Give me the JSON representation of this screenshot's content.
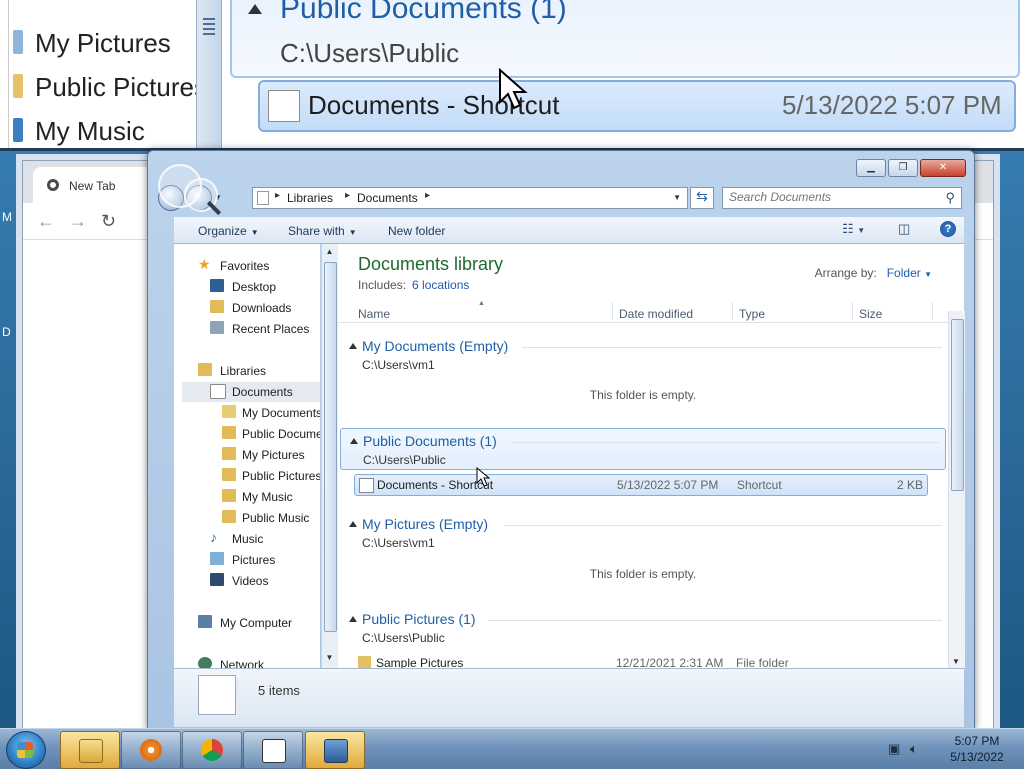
{
  "zoom": {
    "nav_items": [
      "My Pictures",
      "Public Pictures",
      "My Music"
    ],
    "group_title": "Public Documents (1)",
    "group_path": "C:\\Users\\Public",
    "item_name": "Documents - Shortcut",
    "item_date": "5/13/2022 5:07 PM"
  },
  "chrome": {
    "tab_title": "New Tab"
  },
  "explorer": {
    "address": {
      "crumbs": [
        "Libraries",
        "Documents"
      ]
    },
    "search_placeholder": "Search Documents",
    "toolbar": {
      "organize": "Organize",
      "share_with": "Share with",
      "new_folder": "New folder"
    },
    "nav": {
      "favorites": "Favorites",
      "desktop": "Desktop",
      "downloads": "Downloads",
      "recent_places": "Recent Places",
      "libraries": "Libraries",
      "documents": "Documents",
      "my_documents": "My Documents",
      "public_documents": "Public Documents",
      "my_pictures": "My Pictures",
      "public_pictures": "Public Pictures",
      "my_music": "My Music",
      "public_music": "Public Music",
      "music": "Music",
      "pictures": "Pictures",
      "videos": "Videos",
      "my_computer": "My Computer",
      "network": "Network"
    },
    "library": {
      "title": "Documents library",
      "includes_label": "Includes:",
      "locations": "6 locations",
      "arrange_by_label": "Arrange by:",
      "arrange_by_value": "Folder"
    },
    "columns": {
      "name": "Name",
      "date_modified": "Date modified",
      "type": "Type",
      "size": "Size"
    },
    "groups": [
      {
        "title": "My Documents (Empty)",
        "path": "C:\\Users\\vm1",
        "empty_text": "This folder is empty."
      },
      {
        "title": "Public Documents (1)",
        "path": "C:\\Users\\Public",
        "items": [
          {
            "name": "Documents - Shortcut",
            "date": "5/13/2022 5:07 PM",
            "type": "Shortcut",
            "size": "2 KB"
          }
        ]
      },
      {
        "title": "My Pictures (Empty)",
        "path": "C:\\Users\\vm1",
        "empty_text": "This folder is empty."
      },
      {
        "title": "Public Pictures (1)",
        "path": "C:\\Users\\Public",
        "items": [
          {
            "name": "Sample Pictures",
            "date": "12/21/2021 2:31 AM",
            "type": "File folder",
            "size": ""
          }
        ]
      }
    ],
    "status": {
      "item_count": "5 items"
    }
  },
  "taskbar": {
    "time": "5:07 PM",
    "date": "5/13/2022"
  },
  "colors": {
    "library_title": "#1e6a2f",
    "link": "#1f5da8",
    "group_title": "#1e5fa8",
    "selection_border": "#84acdd"
  }
}
